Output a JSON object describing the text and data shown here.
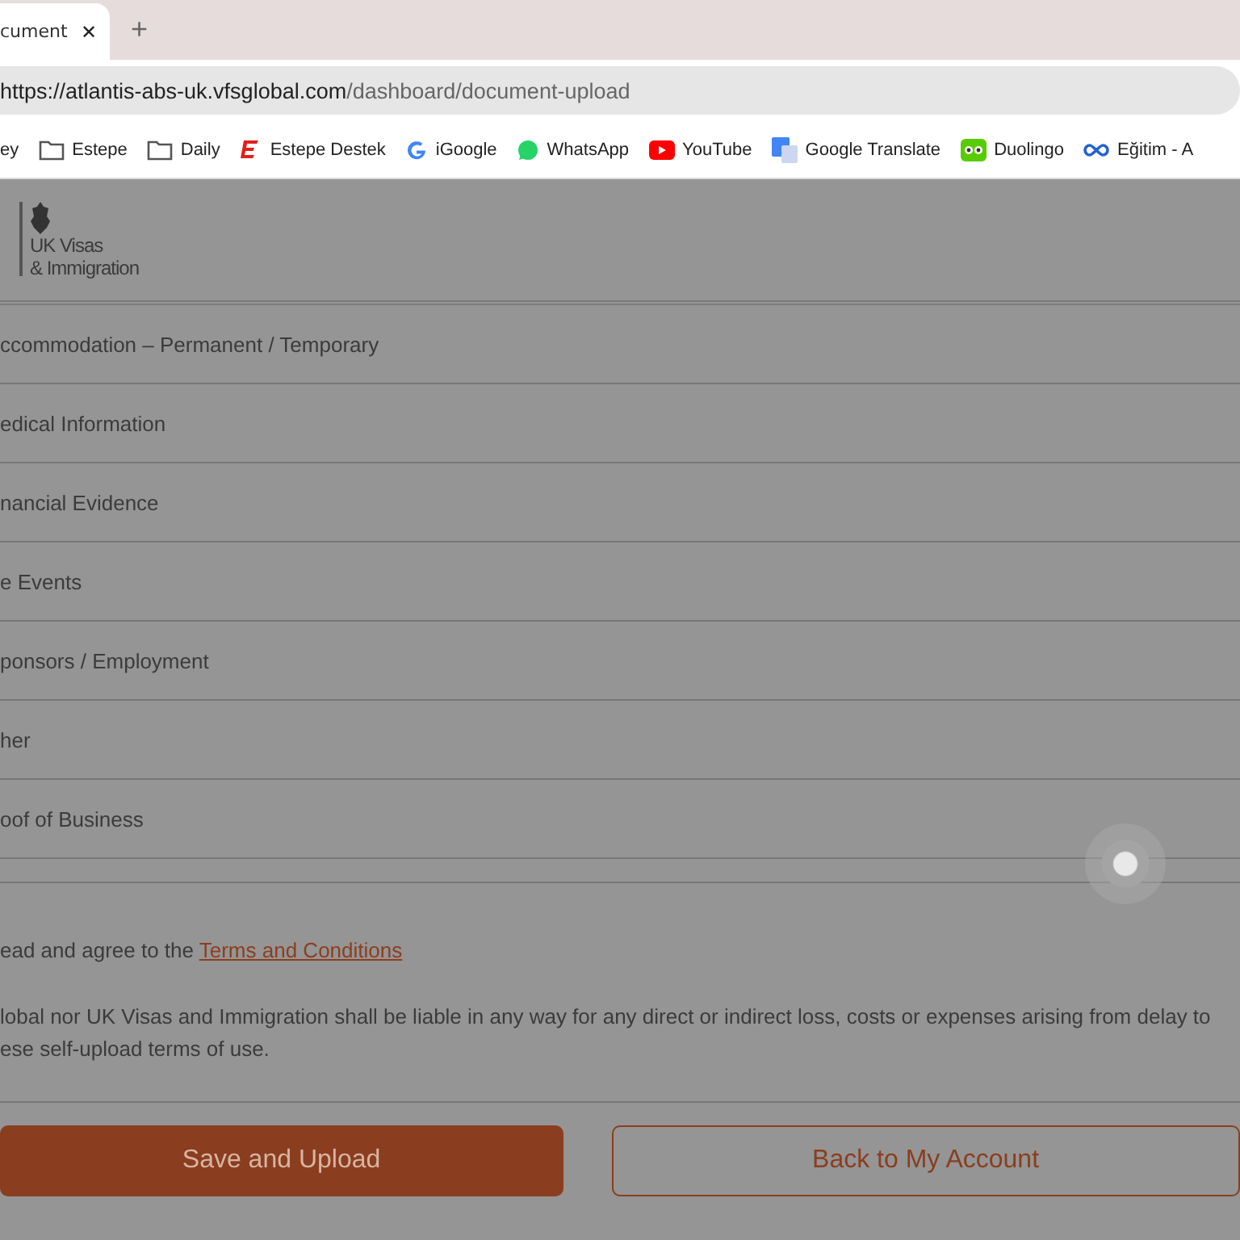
{
  "browser": {
    "tab": {
      "title": "cument",
      "close": "✕"
    },
    "new_tab": "+",
    "address": {
      "host": "https://atlantis-abs-uk.vfsglobal.com",
      "path": "/dashboard/document-upload"
    },
    "bookmarks": [
      {
        "kind": "text",
        "label": "ey"
      },
      {
        "kind": "folder",
        "label": "Estepe"
      },
      {
        "kind": "folder",
        "label": "Daily"
      },
      {
        "kind": "brand-e",
        "label": "Estepe Destek"
      },
      {
        "kind": "google",
        "label": "iGoogle"
      },
      {
        "kind": "whatsapp",
        "label": "WhatsApp"
      },
      {
        "kind": "youtube",
        "label": "YouTube"
      },
      {
        "kind": "translate",
        "label": "Google Translate"
      },
      {
        "kind": "owl",
        "label": "Duolingo"
      },
      {
        "kind": "link",
        "label": "Eğitim - A"
      }
    ]
  },
  "logo": {
    "line1": "UK Visas",
    "line2": "& Immigration"
  },
  "sections": [
    "ccommodation – Permanent / Temporary",
    "edical Information",
    "nancial Evidence",
    "e Events",
    "ponsors / Employment",
    "her",
    "oof of Business"
  ],
  "terms": {
    "text": "ead and agree to the ",
    "link": "Terms and Conditions"
  },
  "disclaimer": "lobal nor UK Visas and Immigration shall be liable in any way for any direct or indirect loss, costs or expenses arising from delay to\nese self-upload terms of use.",
  "buttons": {
    "primary": "Save and Upload",
    "secondary": "Back to My Account"
  },
  "loading": true
}
